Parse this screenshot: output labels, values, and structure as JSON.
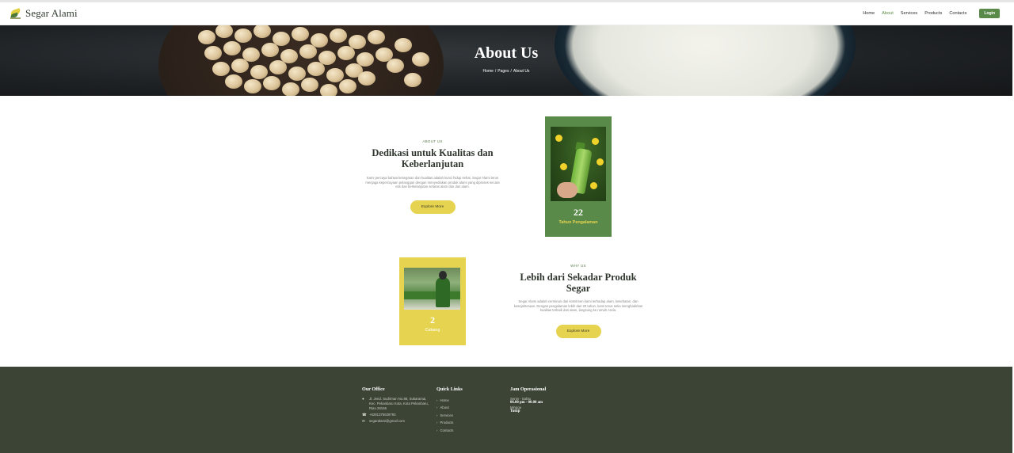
{
  "brand": {
    "name": "Segar Alami"
  },
  "nav": {
    "items": [
      "Home",
      "About",
      "Services",
      "Products",
      "Contacts"
    ],
    "active": "About",
    "login_label": "Login"
  },
  "hero": {
    "title": "About Us",
    "breadcrumb": [
      "Home",
      "Pages",
      "About Us"
    ]
  },
  "about": {
    "eyebrow": "ABOUT US",
    "heading": "Dedikasi untuk Kualitas dan Keberlanjutan",
    "text": "Kami percaya bahwa kesegaran dan kualitas adalah kunci hidup sehat. Segar Alami terus menjaga kepercayaan pelanggan dengan menyediakan produk alami yang diproses secara etis dan berkelanjutan selaras alam dan dari alam.",
    "button": "Explore More",
    "card": {
      "number": "22",
      "label": "Tahun Pengalaman"
    }
  },
  "why": {
    "eyebrow": "WHY US",
    "heading": "Lebih dari Sekadar Produk Segar",
    "text": "Segar Alami adalah cerminan dari komitmen kami terhadap alam, kesehatan, dan kesejahteraan. Dengan pengalaman lebih dari 20 tahun, kami terus setia menghadirkan kualitas terbaik dari alam, langsung ke rumah Anda.",
    "button": "Explore More",
    "card": {
      "number": "2",
      "label": "Cabang"
    }
  },
  "footer": {
    "office": {
      "title": "Our Office",
      "address": "Jl. Jend. Sudirman No.88, Sukaramai, Kec. Pekanbaru Kota, Kota Pekanbaru, Riau 28156",
      "phone": "+6281375628793",
      "email": "segaralami@gmail.com"
    },
    "links": {
      "title": "Quick Links",
      "items": [
        "Home",
        "About",
        "Services",
        "Products",
        "Contacts"
      ]
    },
    "hours": {
      "title": "Jam Operasional",
      "weekday": "Senin - Sabtu",
      "weekday_time": "06.00 pm - 00.00 am",
      "weekend": "Minggu",
      "weekend_time": "Tutup"
    }
  },
  "colors": {
    "green": "#5a8a4a",
    "yellow": "#e6d34f",
    "footer": "#3c4436"
  }
}
